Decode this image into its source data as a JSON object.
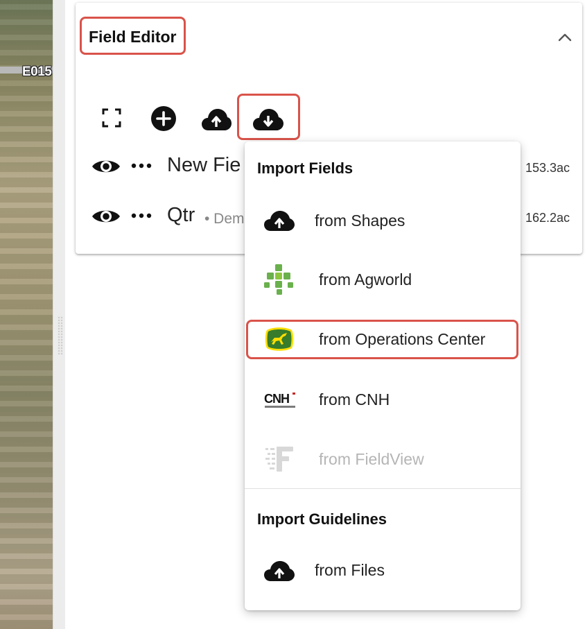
{
  "map": {
    "label": "E015"
  },
  "card": {
    "title": "Field Editor",
    "fields": [
      {
        "name": "New Fie",
        "sub": "",
        "acres": "153.3ac"
      },
      {
        "name": "Qtr",
        "sub": "• Dem",
        "acres": "162.2ac"
      }
    ]
  },
  "menu": {
    "import_fields_header": "Import Fields",
    "items": [
      {
        "label": "from Shapes",
        "icon": "cloud-upload-icon",
        "enabled": true
      },
      {
        "label": "from Agworld",
        "icon": "agworld-logo-icon",
        "enabled": true
      },
      {
        "label": "from Operations Center",
        "icon": "john-deere-logo-icon",
        "enabled": true
      },
      {
        "label": "from CNH",
        "icon": "cnh-logo-icon",
        "enabled": true
      },
      {
        "label": "from FieldView",
        "icon": "fieldview-logo-icon",
        "enabled": false
      }
    ],
    "import_guidelines_header": "Import Guidelines",
    "guideline_items": [
      {
        "label": "from Files",
        "icon": "cloud-upload-icon",
        "enabled": true
      }
    ]
  },
  "colors": {
    "highlight": "#d9534a",
    "agworld_green": "#6ab04c",
    "deere_green": "#367c2b",
    "deere_yellow": "#ffde00",
    "disabled_text": "#b5b5b5"
  }
}
